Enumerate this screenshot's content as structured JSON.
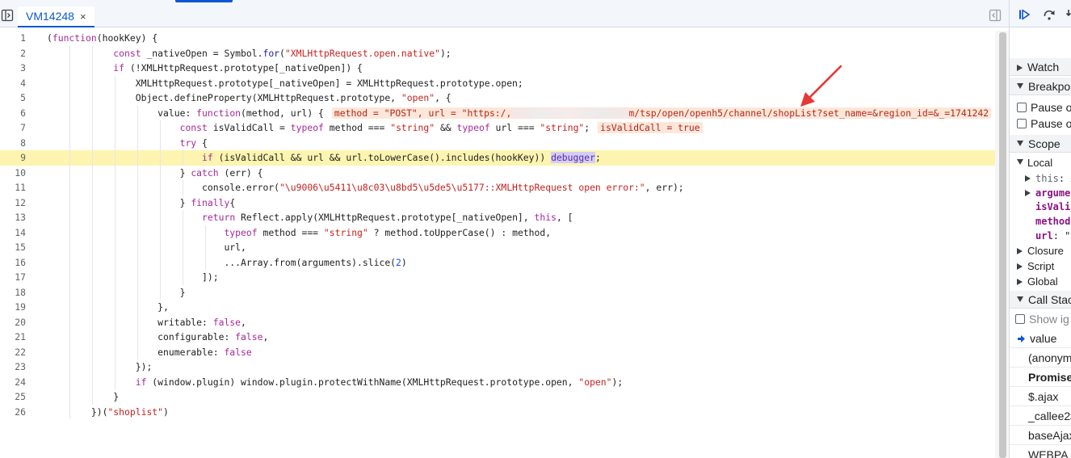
{
  "editor": {
    "tab": {
      "label": "VM14248",
      "close": "×"
    },
    "lines": [
      {
        "num": "1",
        "html": "<span class=\"paren\">(</span><span class=\"kw\">function</span>(hookKey) {"
      },
      {
        "num": "2",
        "html": "            <span class=\"kw\">const</span> _nativeOpen = Symbol.<span class=\"prop\">for</span>(<span class=\"str\">\"XMLHttpRequest.open.native\"</span>);"
      },
      {
        "num": "3",
        "html": "            <span class=\"kw\">if</span> (!XMLHttpRequest.prototype[_nativeOpen]) {"
      },
      {
        "num": "4",
        "html": "                XMLHttpRequest.prototype[_nativeOpen] = XMLHttpRequest.prototype.open;"
      },
      {
        "num": "5",
        "html": "                Object.defineProperty(XMLHttpRequest.prototype, <span class=\"str\">\"open\"</span>, {"
      },
      {
        "num": "6",
        "html": "                    value: <span class=\"kw\">function</span>(method, url) {<span class=\"inline-val\">method = \"POST\", url = \"https:/,<span class=\"blur\"></span>m/tsp/open/openh5/channel/shopList?set_name=&amp;region_id=&amp;_=1741242</span>"
      },
      {
        "num": "7",
        "html": "                        <span class=\"kw\">const</span> isValidCall = <span class=\"kw\">typeof</span> method === <span class=\"str\">\"string\"</span> &amp;&amp; <span class=\"kw\">typeof</span> url === <span class=\"str\">\"string\"</span>;<span class=\"inline-val\">isValidCall = true</span>"
      },
      {
        "num": "8",
        "html": "                        <span class=\"kw\">try</span> {"
      },
      {
        "num": "9",
        "html": "                            <span class=\"kw\">if</span> (isValidCall &amp;&amp; url &amp;&amp; url.toLowerCase().includes(hookKey)) <span class=\"bp-kw\">debugger</span>;",
        "paused": true
      },
      {
        "num": "10",
        "html": "                        } <span class=\"kw\">catch</span> (err) {"
      },
      {
        "num": "11",
        "html": "                            console.error(<span class=\"str\">\"\\u9006\\u5411\\u8c03\\u8bd5\\u5de5\\u5177::XMLHttpRequest open error:\"</span>, err);"
      },
      {
        "num": "12",
        "html": "                        } <span class=\"kw\">finally</span>{"
      },
      {
        "num": "13",
        "html": "                            <span class=\"kw\">return</span> Reflect.apply(XMLHttpRequest.prototype[_nativeOpen], <span class=\"kw\">this</span>, ["
      },
      {
        "num": "14",
        "html": "                                <span class=\"kw\">typeof</span> method === <span class=\"str\">\"string\"</span> ? method.toUpperCase() : method,"
      },
      {
        "num": "15",
        "html": "                                url,"
      },
      {
        "num": "16",
        "html": "                                ...Array.from(arguments).slice(<span class=\"num\">2</span>)"
      },
      {
        "num": "17",
        "html": "                            ]);"
      },
      {
        "num": "18",
        "html": "                        }"
      },
      {
        "num": "19",
        "html": "                    },"
      },
      {
        "num": "20",
        "html": "                    writable: <span class=\"kw\">false</span>,"
      },
      {
        "num": "21",
        "html": "                    configurable: <span class=\"kw\">false</span>,"
      },
      {
        "num": "22",
        "html": "                    enumerable: <span class=\"kw\">false</span>"
      },
      {
        "num": "23",
        "html": "                });"
      },
      {
        "num": "24",
        "html": "                <span class=\"kw\">if</span> (window.plugin) window.plugin.protectWithName(XMLHttpRequest.prototype.open, <span class=\"str\">\"open\"</span>);"
      },
      {
        "num": "25",
        "html": "            }"
      },
      {
        "num": "26",
        "html": "        })(<span class=\"str\">\"shoplist\"</span>)"
      }
    ]
  },
  "sidebar": {
    "sections": {
      "watch": "Watch",
      "breakpoints": "Breakpo",
      "pause_uncaught": "Pause o",
      "pause_caught": "Pause o",
      "scope": "Scope",
      "local": "Local",
      "closure": "Closure",
      "script": "Script",
      "global": "Global",
      "call_stack": "Call Stac",
      "show_ignored": "Show ig"
    },
    "scope_items": {
      "this_name": "this",
      "this_val": ": X",
      "arguments": "argume",
      "isvalid": "isVali",
      "method": "method",
      "url_name": "url",
      "url_val": ": \""
    },
    "call_stack": [
      "value",
      "(anonym",
      "Promise",
      "$.ajax",
      "_callee2$",
      "baseAjax",
      "WEBPA"
    ]
  },
  "colors": {
    "accent": "#0b57d0",
    "paused_line": "#fdf4b0",
    "arrow": "#e53935"
  }
}
